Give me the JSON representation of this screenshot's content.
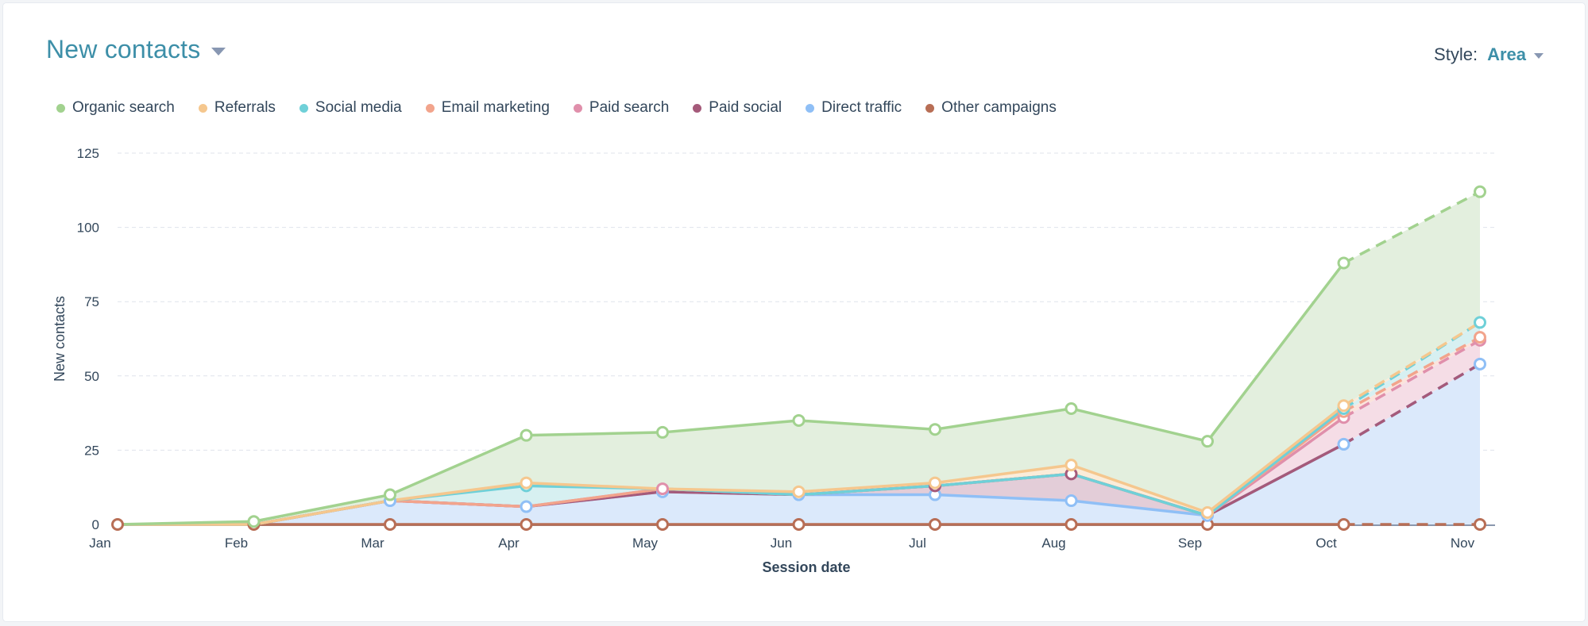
{
  "header": {
    "title": "New contacts",
    "style_label": "Style:",
    "style_value": "Area"
  },
  "legend": [
    {
      "name": "Organic search",
      "color": "#a2d28f"
    },
    {
      "name": "Referrals",
      "color": "#f5c78e"
    },
    {
      "name": "Social media",
      "color": "#6fd0d8"
    },
    {
      "name": "Email marketing",
      "color": "#f2a48c"
    },
    {
      "name": "Paid search",
      "color": "#e08fab"
    },
    {
      "name": "Paid social",
      "color": "#a55a7a"
    },
    {
      "name": "Direct traffic",
      "color": "#8fbff6"
    },
    {
      "name": "Other campaigns",
      "color": "#b86e55"
    }
  ],
  "chart_data": {
    "type": "area",
    "stacked": true,
    "title": "New contacts",
    "xlabel": "Session date",
    "ylabel": "New contacts",
    "categories": [
      "Jan",
      "Feb",
      "Mar",
      "Apr",
      "May",
      "Jun",
      "Jul",
      "Aug",
      "Sep",
      "Oct",
      "Nov"
    ],
    "ylim": [
      0,
      125
    ],
    "yticks": [
      0,
      25,
      50,
      75,
      100,
      125
    ],
    "grid": true,
    "legend_position": "top-left",
    "projected_from_index": 9,
    "stack_order_bottom_to_top": [
      "Other campaigns",
      "Direct traffic",
      "Paid social",
      "Paid search",
      "Email marketing",
      "Social media",
      "Referrals",
      "Organic search"
    ],
    "series": [
      {
        "name": "Other campaigns",
        "color": "#b86e55",
        "fill": "#b86e55",
        "values": [
          0,
          0,
          0,
          0,
          0,
          0,
          0,
          0,
          0,
          0,
          0
        ]
      },
      {
        "name": "Direct traffic",
        "color": "#8fbff6",
        "fill": "#dbe9fb",
        "values": [
          0,
          0,
          8,
          6,
          11,
          10,
          10,
          8,
          3,
          27,
          54
        ]
      },
      {
        "name": "Paid social",
        "color": "#a55a7a",
        "fill": "#e3cdd8",
        "values": [
          0,
          0,
          0,
          0,
          0,
          0,
          3,
          9,
          0,
          0,
          0
        ]
      },
      {
        "name": "Paid search",
        "color": "#e08fab",
        "fill": "#f5dde6",
        "values": [
          0,
          0,
          0,
          0,
          1,
          0,
          0,
          0,
          0,
          9,
          8
        ]
      },
      {
        "name": "Email marketing",
        "color": "#f2a48c",
        "fill": "#fbe4dc",
        "values": [
          0,
          0,
          0,
          0,
          0,
          0,
          0,
          0,
          0,
          2,
          1
        ]
      },
      {
        "name": "Social media",
        "color": "#6fd0d8",
        "fill": "#d7f0f1",
        "values": [
          0,
          0,
          0,
          7,
          0,
          0,
          0,
          0,
          0,
          1,
          5
        ]
      },
      {
        "name": "Referrals",
        "color": "#f5c78e",
        "fill": "#fbecd9",
        "values": [
          0,
          0,
          0,
          1,
          0,
          1,
          1,
          3,
          1,
          1,
          0
        ]
      },
      {
        "name": "Organic search",
        "color": "#a2d28f",
        "fill": "#e3efde",
        "values": [
          0,
          1,
          2,
          16,
          19,
          24,
          18,
          19,
          24,
          48,
          44
        ]
      }
    ]
  }
}
